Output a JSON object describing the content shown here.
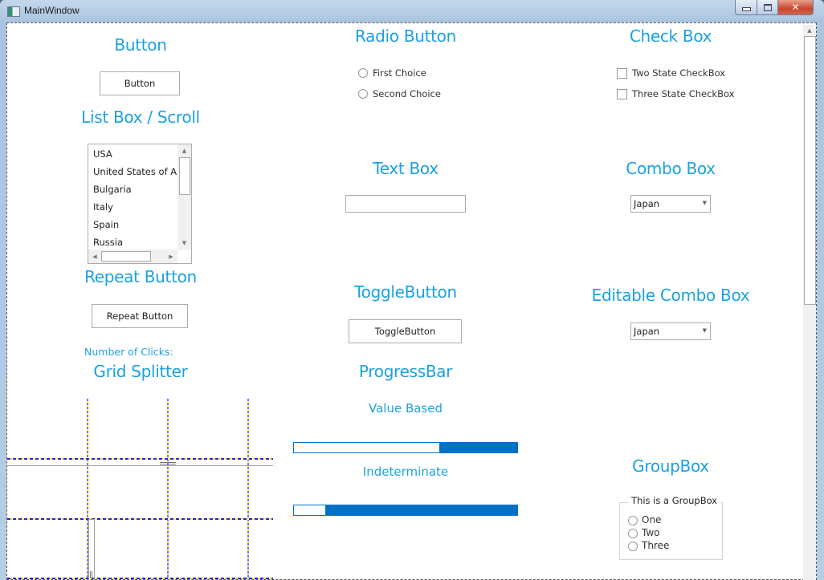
{
  "window": {
    "title": "MainWindow",
    "controls": {
      "minimize": "minimize-icon",
      "maximize": "maximize-icon",
      "close": "close-icon"
    }
  },
  "sections": {
    "button": {
      "heading": "Button",
      "button_label": "Button"
    },
    "listbox": {
      "heading": "List Box / Scroll",
      "items": [
        "USA",
        "United States of Am",
        "Bulgaria",
        "Italy",
        "Spain",
        "Russia"
      ]
    },
    "repeat_button": {
      "heading": "Repeat Button",
      "button_label": "Repeat Button",
      "clicks_label": "Number of Clicks:"
    },
    "grid_splitter": {
      "heading": "Grid Splitter"
    },
    "radio_button": {
      "heading": "Radio Button",
      "options": [
        "First Choice",
        "Second Choice"
      ]
    },
    "text_box": {
      "heading": "Text Box",
      "value": ""
    },
    "toggle_button": {
      "heading": "ToggleButton",
      "button_label": "ToggleButton"
    },
    "progress_bar": {
      "heading": "ProgressBar",
      "value_based_label": "Value Based",
      "indeterminate_label": "Indeterminate",
      "value_based_unfilled_fraction": 0.65,
      "indeterminate_gap_fraction": 0.14
    },
    "check_box": {
      "heading": "Check Box",
      "options": [
        "Two State CheckBox",
        "Three State CheckBox"
      ]
    },
    "combo_box": {
      "heading": "Combo Box",
      "selected": "Japan"
    },
    "editable_combo_box": {
      "heading": "Editable Combo Box",
      "selected": "Japan"
    },
    "group_box": {
      "heading": "GroupBox",
      "title": "This is a GroupBox",
      "options": [
        "One",
        "Two",
        "Three"
      ]
    }
  },
  "colors": {
    "accent": "#1ba1e2",
    "progress": "#0072c6"
  }
}
